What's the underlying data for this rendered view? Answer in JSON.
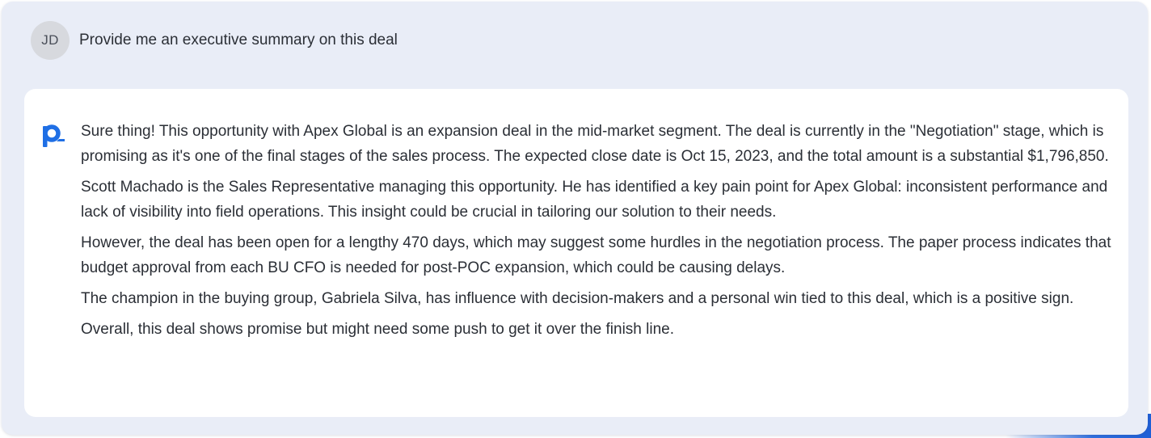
{
  "user": {
    "initials": "JD",
    "message": "Provide me an executive summary on this deal"
  },
  "assistant": {
    "logo": "p-brand-icon",
    "paragraphs": [
      "Sure thing! This opportunity with Apex Global is an expansion deal in the mid-market segment. The deal is currently in the \"Negotiation\" stage, which is promising as it's one of the final stages of the sales process. The expected close date is Oct 15, 2023, and the total amount is a substantial $1,796,850.",
      "Scott Machado is the Sales Representative managing this opportunity. He has identified a key pain point for Apex Global: inconsistent performance and lack of visibility into field operations. This insight could be crucial in tailoring our solution to their needs.",
      "However, the deal has been open for a lengthy 470 days, which may suggest some hurdles in the negotiation process. The paper process indicates that budget approval from each BU CFO is needed for post-POC expansion, which could be causing delays.",
      "The champion in the buying group, Gabriela Silva, has influence with decision-makers and a personal win tied to this deal, which is a positive sign.",
      "Overall, this deal shows promise but might need some push to get it over the finish line."
    ]
  },
  "colors": {
    "panel_background": "#e9edf7",
    "card_background": "#ffffff",
    "avatar_background": "#d7d9de",
    "brand_blue": "#1f6fe5",
    "text": "#2b2f36"
  }
}
